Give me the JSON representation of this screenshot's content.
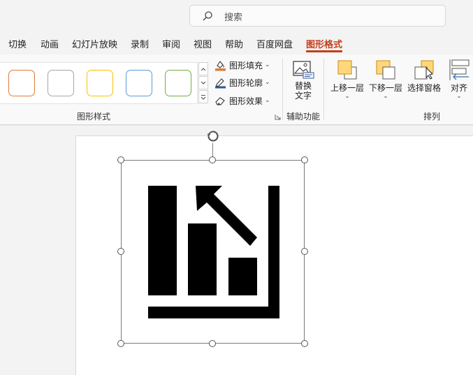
{
  "search": {
    "placeholder": "搜索"
  },
  "tabs": [
    {
      "label": "切换"
    },
    {
      "label": "动画"
    },
    {
      "label": "幻灯片放映"
    },
    {
      "label": "录制"
    },
    {
      "label": "审阅"
    },
    {
      "label": "视图"
    },
    {
      "label": "帮助"
    },
    {
      "label": "百度网盘"
    },
    {
      "label": "图形格式",
      "active": true
    }
  ],
  "ribbon": {
    "shape_styles": {
      "group_label": "图形样式",
      "swatch_colors": [
        "#e07b39",
        "#a6a6a6",
        "#ffc000",
        "#5b9bd5",
        "#70ad47"
      ],
      "fill_label": "图形填充",
      "outline_label": "图形轮廓",
      "effects_label": "图形效果"
    },
    "accessibility": {
      "group_label": "辅助功能",
      "alt_text_line1": "替换",
      "alt_text_line2": "文字"
    },
    "arrange": {
      "group_label": "排列",
      "bring_forward_label": "上移一层",
      "send_backward_label": "下移一层",
      "selection_pane_label": "选择窗格",
      "align_label": "对齐"
    }
  },
  "colors": {
    "accent": "#c43e1c",
    "fill_bar": "#e07b39",
    "outline_bar": "#2f5597",
    "arrange_icon_fill": "#ffd77a",
    "arrange_icon_stroke": "#d39b2a"
  },
  "icons": {
    "search": "search-icon",
    "fill": "paint-bucket-icon",
    "outline": "pen-outline-icon",
    "effects": "eraser-effects-icon",
    "alt_text": "image-alt-text-icon",
    "rotate": "rotate-handle-icon",
    "graphic": "bar-chart-decrease-icon"
  }
}
